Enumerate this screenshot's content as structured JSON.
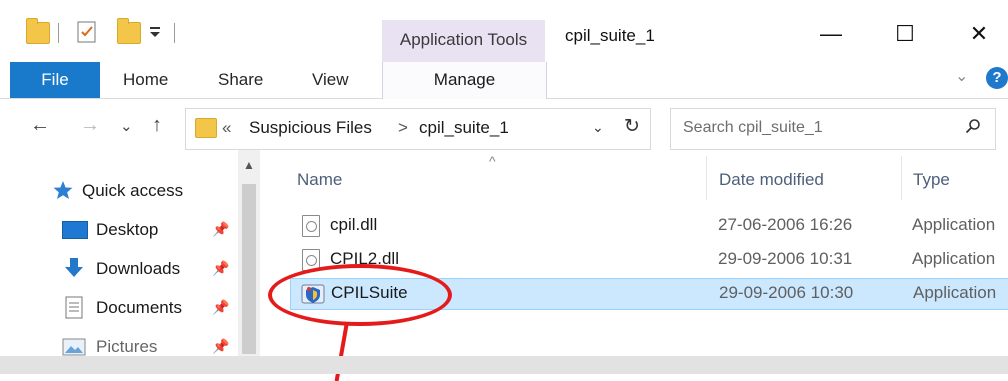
{
  "titlebar": {
    "context_tab": "Application Tools",
    "window_title": "cpil_suite_1",
    "minimize": "—",
    "maximize": "☐",
    "close": "✕"
  },
  "ribbon": {
    "tabs": [
      "File",
      "Home",
      "Share",
      "View"
    ],
    "manage": "Manage",
    "help": "?"
  },
  "navbar": {
    "back": "←",
    "forward": "→",
    "recent": "⌄",
    "up": "↑",
    "overflow": "«",
    "breadcrumb": [
      "Suspicious Files",
      "cpil_suite_1"
    ],
    "separator": ">",
    "search_placeholder": "Search cpil_suite_1"
  },
  "nav_pane": {
    "quick_access": "Quick access",
    "items": [
      {
        "label": "Desktop",
        "icon": "desktop-icon"
      },
      {
        "label": "Downloads",
        "icon": "downloads-icon"
      },
      {
        "label": "Documents",
        "icon": "documents-icon"
      },
      {
        "label": "Pictures",
        "icon": "pictures-icon"
      }
    ]
  },
  "file_list": {
    "columns": [
      "Name",
      "Date modified",
      "Type"
    ],
    "rows": [
      {
        "name": "cpil.dll",
        "date": "27-06-2006 16:26",
        "type": "Application",
        "icon": "dll-file-icon"
      },
      {
        "name": "CPIL2.dll",
        "date": "29-09-2006 10:31",
        "type": "Application",
        "icon": "dll-file-icon"
      },
      {
        "name": "CPILSuite",
        "date": "29-09-2006 10:30",
        "type": "Application",
        "icon": "application-icon",
        "selected": true
      }
    ]
  },
  "colors": {
    "file_tab": "#1979ca",
    "context_tab": "#e9e2f2",
    "selection": "#cce8ff",
    "annotation": "#e51b1b"
  }
}
